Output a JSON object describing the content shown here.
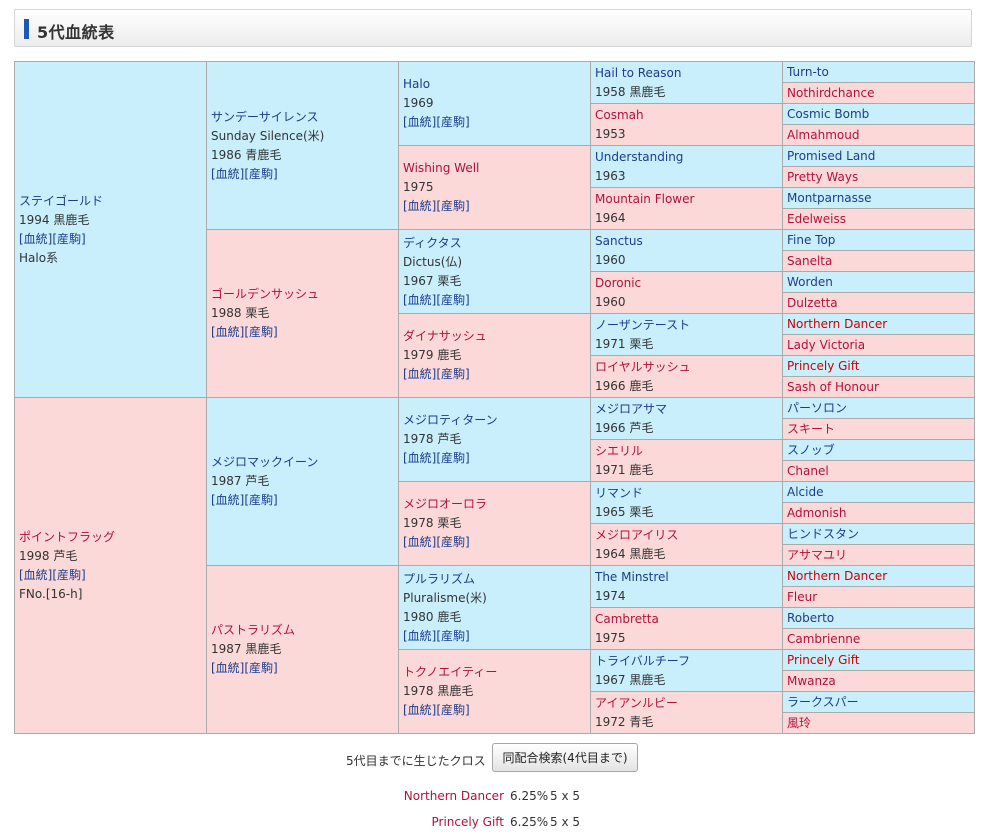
{
  "header": {
    "title": "5代血統表"
  },
  "links": {
    "ketto": "[血統]",
    "sanku": "[産駒]"
  },
  "gen1": [
    {
      "name": "ステイゴールド",
      "info": "1994 黒鹿毛",
      "extra": "Halo系"
    },
    {
      "name": "ポイントフラッグ",
      "info": "1998 芦毛",
      "extra": "FNo.[16-h]"
    }
  ],
  "gen2": [
    {
      "name": "サンデーサイレンス",
      "name2": "Sunday Silence(米)",
      "info": "1986 青鹿毛"
    },
    {
      "name": "ゴールデンサッシュ",
      "name2": "",
      "info": "1988 栗毛"
    },
    {
      "name": "メジロマックイーン",
      "name2": "",
      "info": "1987 芦毛"
    },
    {
      "name": "パストラリズム",
      "name2": "",
      "info": "1987 黒鹿毛"
    }
  ],
  "gen3": [
    {
      "name": "Halo",
      "name2": "",
      "info": "1969"
    },
    {
      "name": "Wishing Well",
      "name2": "",
      "info": "1975"
    },
    {
      "name": "ディクタス",
      "name2": "Dictus(仏)",
      "info": "1967 栗毛"
    },
    {
      "name": "ダイナサッシュ",
      "name2": "",
      "info": "1979 鹿毛"
    },
    {
      "name": "メジロティターン",
      "name2": "",
      "info": "1978 芦毛"
    },
    {
      "name": "メジロオーロラ",
      "name2": "",
      "info": "1978 栗毛"
    },
    {
      "name": "プルラリズム",
      "name2": "Pluralisme(米)",
      "info": "1980 鹿毛"
    },
    {
      "name": "トクノエイティー",
      "name2": "",
      "info": "1978 黒鹿毛"
    }
  ],
  "gen4": [
    {
      "name": "Hail to Reason",
      "info": "1958 黒鹿毛"
    },
    {
      "name": "Cosmah",
      "info": "1953"
    },
    {
      "name": "Understanding",
      "info": "1963"
    },
    {
      "name": "Mountain Flower",
      "info": "1964"
    },
    {
      "name": "Sanctus",
      "info": "1960"
    },
    {
      "name": "Doronic",
      "info": "1960"
    },
    {
      "name": "ノーザンテースト",
      "info": "1971 栗毛"
    },
    {
      "name": "ロイヤルサッシュ",
      "info": "1966 鹿毛"
    },
    {
      "name": "メジロアサマ",
      "info": "1966 芦毛"
    },
    {
      "name": "シエリル",
      "info": "1971 鹿毛"
    },
    {
      "name": "リマンド",
      "info": "1965 栗毛"
    },
    {
      "name": "メジロアイリス",
      "info": "1964 黒鹿毛"
    },
    {
      "name": "The Minstrel",
      "info": "1974"
    },
    {
      "name": "Cambretta",
      "info": "1975"
    },
    {
      "name": "トライバルチーフ",
      "info": "1967 黒鹿毛"
    },
    {
      "name": "アイアンルビー",
      "info": "1972 青毛"
    }
  ],
  "gen5": [
    "Turn-to",
    "Nothirdchance",
    "Cosmic Bomb",
    "Almahmoud",
    "Promised Land",
    "Pretty Ways",
    "Montparnasse",
    "Edelweiss",
    "Fine Top",
    "Sanelta",
    "Worden",
    "Dulzetta",
    "Northern Dancer",
    "Lady Victoria",
    "Princely Gift",
    "Sash of Honour",
    "パーソロン",
    "スキート",
    "スノッブ",
    "Chanel",
    "Alcide",
    "Admonish",
    "ヒンドスタン",
    "アサマユリ",
    "Northern Dancer",
    "Fleur",
    "Roberto",
    "Cambrienne",
    "Princely Gift",
    "Mwanza",
    "ラークスパー",
    "風玲"
  ],
  "gen5_highlight_indices": [
    12,
    14,
    24,
    28
  ],
  "crosses": {
    "label": "5代目までに生じたクロス",
    "button_label": "同配合検索(4代目まで)",
    "items": [
      {
        "name": "Northern Dancer",
        "pct": "6.25%",
        "gen": "5 x 5"
      },
      {
        "name": "Princely Gift",
        "pct": "6.25%",
        "gen": "5 x 5"
      }
    ]
  },
  "colors": {
    "male_bg": "#c9effc",
    "female_bg": "#fcd9d9",
    "header_accent": "#1e58b4",
    "cross_name": "#b0123c"
  }
}
